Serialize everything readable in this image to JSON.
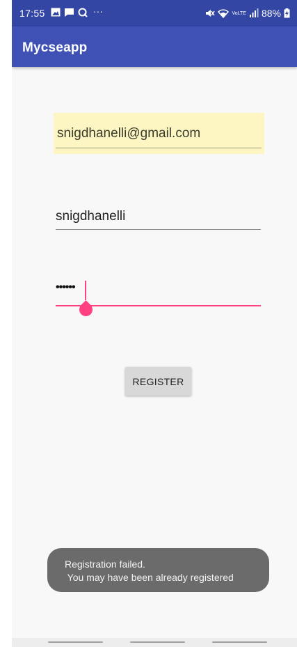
{
  "status_bar": {
    "time": "17:55",
    "left_icons": [
      "image-icon",
      "message-icon",
      "q-icon",
      "more-icon"
    ],
    "more_text": "···",
    "battery_percent": "88%",
    "volte_label": "VoLTE"
  },
  "app_bar": {
    "title": "Mycseapp",
    "color": "#3f51b5",
    "status_color": "#3346a4"
  },
  "form": {
    "email_value": "snigdhanelli@gmail.com",
    "username_value": "snigdhanelli",
    "password_value": "••••••",
    "register_label": "REGISTER",
    "accent_color": "#ff4081",
    "autofill_highlight_color": "#fdf6c3"
  },
  "toast": {
    "line1": "Registration failed.",
    "line2": " You may have been already registered"
  }
}
